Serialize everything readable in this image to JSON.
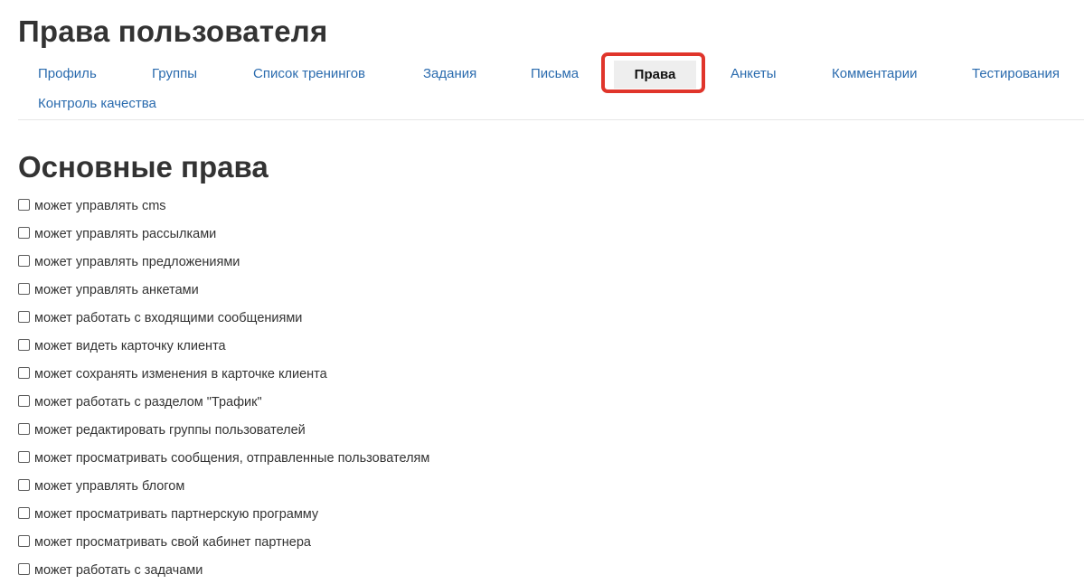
{
  "page": {
    "title": "Права пользователя"
  },
  "tabs": {
    "items": [
      {
        "label": "Профиль"
      },
      {
        "label": "Группы"
      },
      {
        "label": "Список тренингов"
      },
      {
        "label": "Задания"
      },
      {
        "label": "Письма"
      },
      {
        "label": "Права",
        "active": true
      },
      {
        "label": "Анкеты"
      },
      {
        "label": "Комментарии"
      },
      {
        "label": "Тестирования"
      },
      {
        "label": "Контроль качества"
      }
    ]
  },
  "permissions": {
    "section_title": "Основные права",
    "items": [
      {
        "label": "может управлять cms",
        "checked": false
      },
      {
        "label": "может управлять рассылками",
        "checked": false
      },
      {
        "label": "может управлять предложениями",
        "checked": false
      },
      {
        "label": "может управлять анкетами",
        "checked": false
      },
      {
        "label": "может работать с входящими сообщениями",
        "checked": false
      },
      {
        "label": "может видеть карточку клиента",
        "checked": false
      },
      {
        "label": "может сохранять изменения в карточке клиента",
        "checked": false
      },
      {
        "label": "может работать с разделом \"Трафик\"",
        "checked": false
      },
      {
        "label": "может редактировать группы пользователей",
        "checked": false
      },
      {
        "label": "может просматривать сообщения, отправленные пользователям",
        "checked": false
      },
      {
        "label": "может управлять блогом",
        "checked": false
      },
      {
        "label": "может просматривать партнерскую программу",
        "checked": false
      },
      {
        "label": "может просматривать свой кабинет партнера",
        "checked": false
      },
      {
        "label": "может работать с задачами",
        "checked": false
      }
    ]
  },
  "colors": {
    "link": "#2a6bae",
    "highlight_border": "#e0352b",
    "active_tab_bg": "#eeeeee",
    "text": "#333333"
  }
}
